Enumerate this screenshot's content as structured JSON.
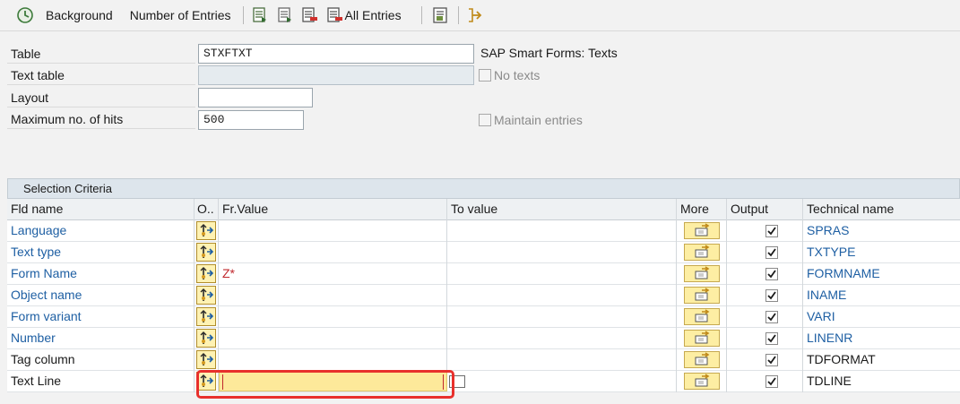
{
  "toolbar": {
    "background_label": "Background",
    "number_entries_label": "Number of Entries",
    "all_entries_label": "All Entries"
  },
  "header": {
    "table_label": "Table",
    "table_value": "STXFTXT",
    "table_desc": "SAP Smart Forms: Texts",
    "text_table_label": "Text table",
    "text_table_value": "",
    "no_texts_label": "No texts",
    "layout_label": "Layout",
    "layout_value": "",
    "max_hits_label": "Maximum no. of hits",
    "max_hits_value": "500",
    "maintain_entries_label": "Maintain entries"
  },
  "selection": {
    "title": "Selection Criteria",
    "columns": {
      "fld_name": "Fld name",
      "op": "O..",
      "fr_value": "Fr.Value",
      "to_value": "To value",
      "more": "More",
      "output": "Output",
      "technical_name": "Technical name"
    },
    "rows": [
      {
        "fld_name": "Language",
        "fr_value": "",
        "to_value": "",
        "output": true,
        "technical_name": "SPRAS"
      },
      {
        "fld_name": "Text type",
        "fr_value": "",
        "to_value": "",
        "output": true,
        "technical_name": "TXTYPE"
      },
      {
        "fld_name": "Form Name",
        "fr_value": "Z*",
        "to_value": "",
        "output": true,
        "technical_name": "FORMNAME"
      },
      {
        "fld_name": "Object name",
        "fr_value": "",
        "to_value": "",
        "output": true,
        "technical_name": "INAME"
      },
      {
        "fld_name": "Form variant",
        "fr_value": "",
        "to_value": "",
        "output": true,
        "technical_name": "VARI"
      },
      {
        "fld_name": "Number",
        "fr_value": "",
        "to_value": "",
        "output": true,
        "technical_name": "LINENR"
      },
      {
        "fld_name": "Tag column",
        "fr_value": "",
        "to_value": "",
        "output": true,
        "technical_name": "TDFORMAT"
      },
      {
        "fld_name": "Text Line",
        "fr_value": "",
        "to_value": "",
        "output": true,
        "technical_name": "TDLINE"
      }
    ]
  },
  "colors": {
    "link_blue": "#1e5fa3",
    "highlight_red": "#e8302c",
    "input_focus_yellow": "#fde99a",
    "value_red": "#c0282d"
  }
}
